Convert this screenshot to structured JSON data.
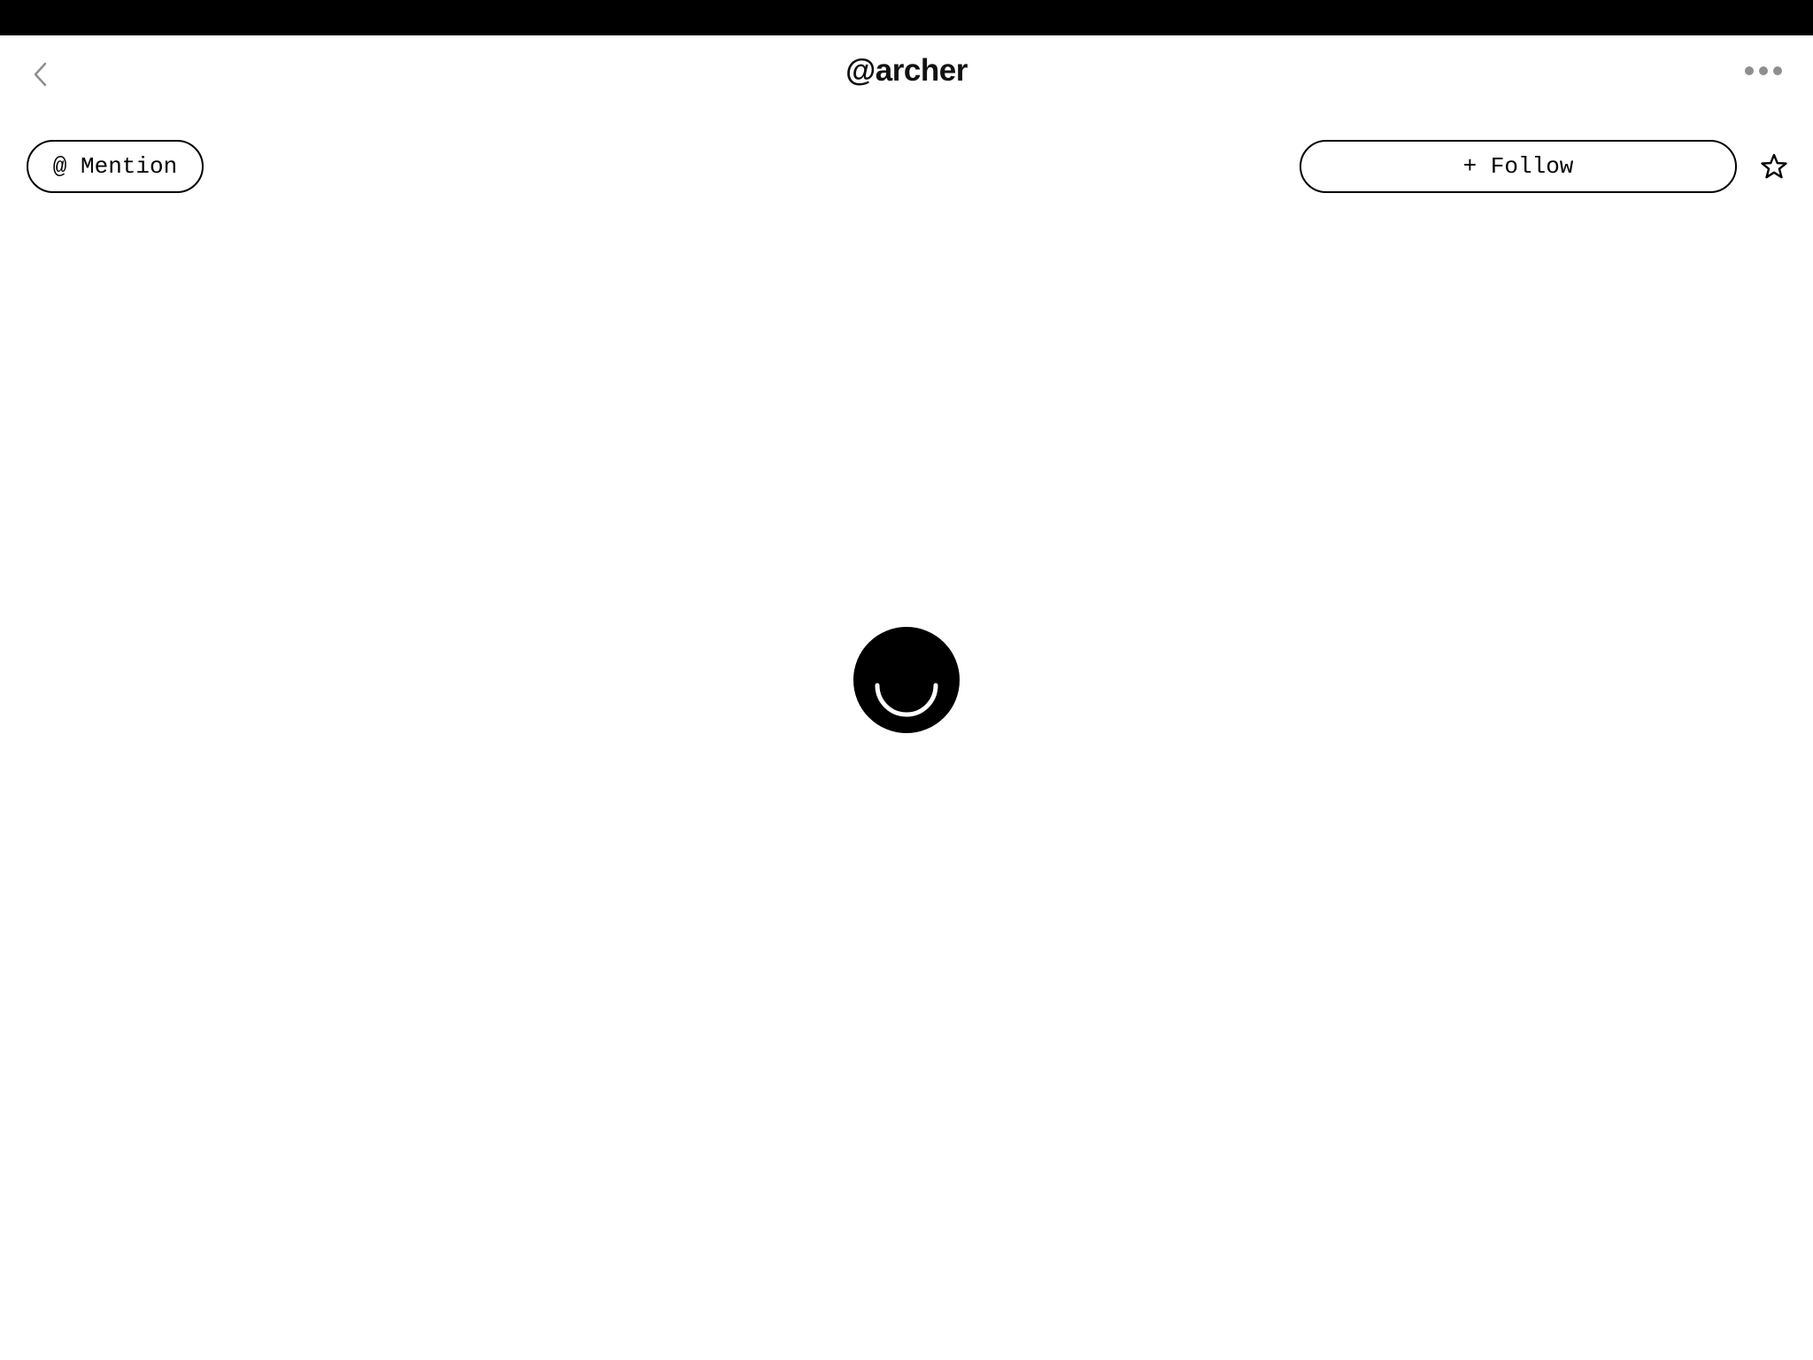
{
  "header": {
    "title": "@archer",
    "back_icon": "chevron-left-icon",
    "more_icon": "ellipsis-icon"
  },
  "actions": {
    "mention_label": "@ Mention",
    "follow_label": "+ Follow",
    "star_icon": "star-icon"
  },
  "avatar": {
    "icon": "smiley-logo-icon",
    "color": "#000000"
  },
  "colors": {
    "status_bar": "#000000",
    "background": "#ffffff",
    "muted_icon": "#8e8e8e"
  }
}
